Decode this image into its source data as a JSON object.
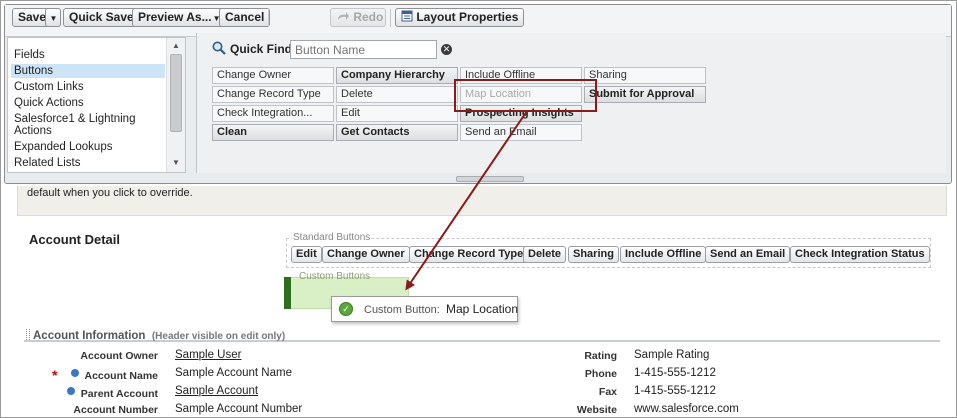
{
  "toolbar": {
    "save": "Save",
    "quick_save": "Quick Save",
    "preview_as": "Preview As...",
    "cancel": "Cancel",
    "redo": "Redo",
    "layout_properties": "Layout Properties"
  },
  "sidebar": {
    "items": [
      "Fields",
      "Buttons",
      "Custom Links",
      "Quick Actions",
      "Salesforce1 & Lightning",
      "Actions",
      "Expanded Lookups",
      "Related Lists"
    ],
    "selected": "Buttons"
  },
  "quick_find": {
    "label": "Quick Find",
    "placeholder": "Button Name",
    "clear_icon": "close-icon"
  },
  "palette_buttons": [
    [
      "Change Owner",
      "Company Hierarchy",
      "Include Offline",
      "Sharing"
    ],
    [
      "Change Record Type",
      "Delete",
      "Map Location",
      "Submit for Approval"
    ],
    [
      "Check Integration...",
      "Edit",
      "Prospecting Insights",
      ""
    ],
    [
      "Clean",
      "Get Contacts",
      "Send an Email",
      ""
    ]
  ],
  "page": {
    "band_text": "default when you click to override.",
    "section_title": "Account Detail",
    "standard_buttons_label": "Standard Buttons",
    "standard_buttons": [
      "Edit",
      "Change Owner",
      "Change Record Type",
      "Delete",
      "Sharing",
      "Include Offline",
      "Send an Email",
      "Check Integration Status"
    ],
    "custom_buttons_label": "Custom Buttons",
    "tooltip_prefix": "Custom Button:",
    "tooltip_value": "Map Location",
    "info_title": "Account Information",
    "info_note": "(Header visible on edit only)"
  },
  "fields_left": [
    {
      "label": "Account Owner",
      "value": "Sample User",
      "link": true
    },
    {
      "label": "Account Name",
      "value": "Sample Account Name",
      "link": false
    },
    {
      "label": "Parent Account",
      "value": "Sample Account",
      "link": true
    },
    {
      "label": "Account Number",
      "value": "Sample Account Number",
      "link": false
    }
  ],
  "fields_right": [
    {
      "label": "Rating",
      "value": "Sample Rating"
    },
    {
      "label": "Phone",
      "value": "1-415-555-1212"
    },
    {
      "label": "Fax",
      "value": "1-415-555-1212"
    },
    {
      "label": "Website",
      "value": "www.salesforce.com"
    }
  ],
  "colors": {
    "highlight_box": "#8b1a1a",
    "custom_zone": "#d9f0c6",
    "custom_bar": "#2f6e1e",
    "selected_item": "#cde3f6"
  }
}
